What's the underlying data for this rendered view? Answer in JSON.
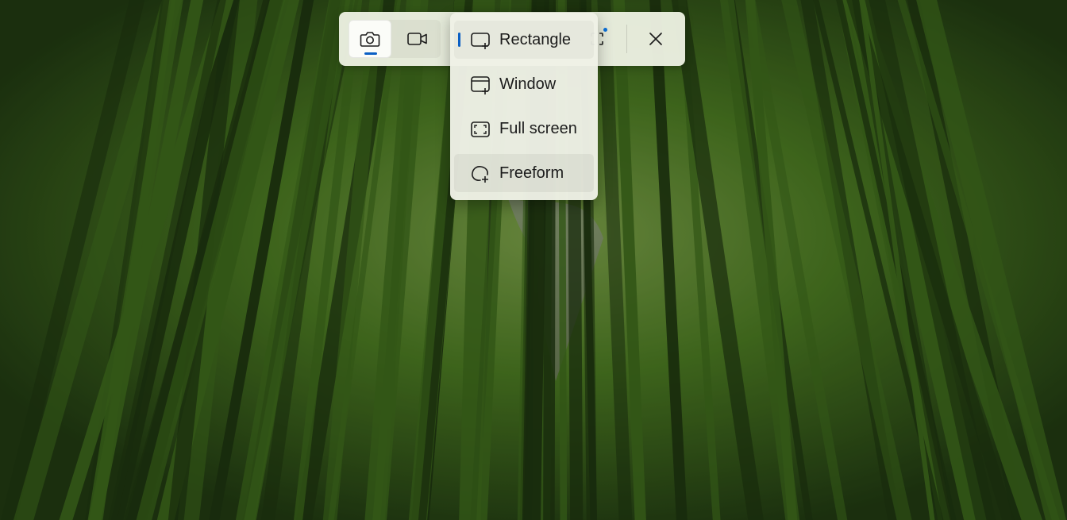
{
  "capture_toolbar": {
    "modes": [
      {
        "name": "snapshot",
        "icon": "camera-icon",
        "active": true
      },
      {
        "name": "record",
        "icon": "video-camera-icon",
        "active": false
      }
    ],
    "shape_button_icon": "capture-shape-icon",
    "close_icon": "close-icon"
  },
  "capture_mode_menu": {
    "items": [
      {
        "label": "Rectangle",
        "icon": "rectangle-snip-icon",
        "selected": true
      },
      {
        "label": "Window",
        "icon": "window-snip-icon",
        "selected": false
      },
      {
        "label": "Full screen",
        "icon": "fullscreen-snip-icon",
        "selected": false
      },
      {
        "label": "Freeform",
        "icon": "freeform-snip-icon",
        "selected": false
      }
    ]
  },
  "colors": {
    "accent": "#0a5fc4",
    "toolbar_background": "#ecf0e2",
    "menu_background": "#eef1e6"
  }
}
